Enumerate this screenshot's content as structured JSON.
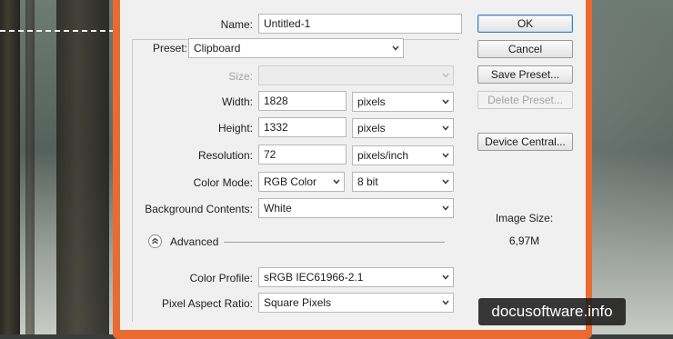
{
  "dialog": {
    "name_label": "Name:",
    "name_value": "Untitled-1",
    "preset_label": "Preset:",
    "preset_value": "Clipboard",
    "size_label": "Size:",
    "size_value": "",
    "width_label": "Width:",
    "width_value": "1828",
    "width_unit": "pixels",
    "height_label": "Height:",
    "height_value": "1332",
    "height_unit": "pixels",
    "resolution_label": "Resolution:",
    "resolution_value": "72",
    "resolution_unit": "pixels/inch",
    "color_mode_label": "Color Mode:",
    "color_mode_value": "RGB Color",
    "bit_depth_value": "8 bit",
    "background_label": "Background Contents:",
    "background_value": "White",
    "advanced_label": "Advanced",
    "color_profile_label": "Color Profile:",
    "color_profile_value": "sRGB IEC61966-2.1",
    "pixel_aspect_label": "Pixel Aspect Ratio:",
    "pixel_aspect_value": "Square Pixels"
  },
  "buttons": {
    "ok": "OK",
    "cancel": "Cancel",
    "save_preset": "Save Preset...",
    "delete_preset": "Delete Preset...",
    "device_central": "Device Central..."
  },
  "image_size": {
    "label": "Image Size:",
    "value": "6,97M"
  },
  "watermark": "docusoftware.info",
  "colors": {
    "frame_accent": "#e96b32",
    "dialog_bg": "#f0f0f0",
    "default_button_border": "#3c7fc1"
  },
  "icons": [
    "chevron-down-icon",
    "collapse-up-icon"
  ]
}
